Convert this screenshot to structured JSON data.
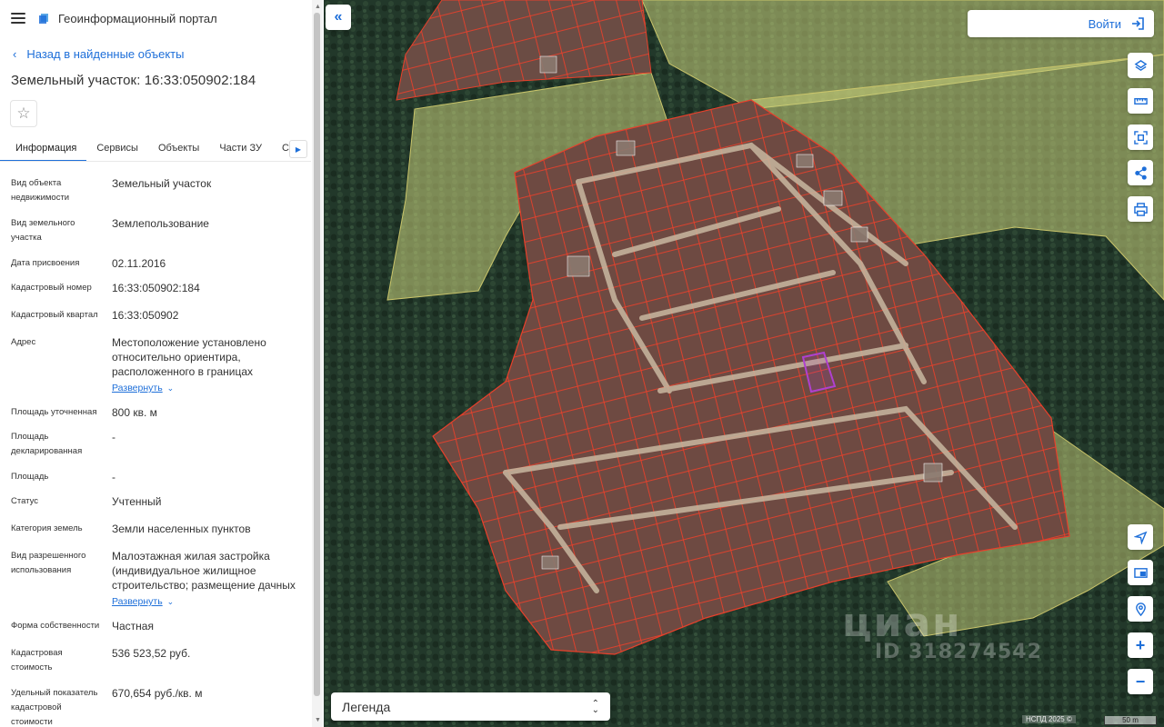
{
  "header": {
    "portal_title": "Геоинформационный портал"
  },
  "nav": {
    "back_label": "Назад в найденные объекты"
  },
  "object": {
    "title": "Земельный участок: 16:33:050902:184"
  },
  "tabs": [
    {
      "label": "Информация",
      "active": true
    },
    {
      "label": "Сервисы"
    },
    {
      "label": "Объекты"
    },
    {
      "label": "Части ЗУ"
    },
    {
      "label": "Сост"
    }
  ],
  "properties": [
    {
      "label": "Вид объекта недвижимости",
      "value": "Земельный участок"
    },
    {
      "label": "Вид земельного участка",
      "value": "Землепользование"
    },
    {
      "label": "Дата присвоения",
      "value": "02.11.2016"
    },
    {
      "label": "Кадастровый номер",
      "value": "16:33:050902:184"
    },
    {
      "label": "Кадастровый квартал",
      "value": "16:33:050902"
    },
    {
      "label": "Адрес",
      "value": "Местоположение установлено относительно ориентира, расположенного в границах",
      "expand": "Развернуть"
    },
    {
      "label": "Площадь уточненная",
      "value": "800 кв. м"
    },
    {
      "label": "Площадь декларированная",
      "value": "-"
    },
    {
      "label": "Площадь",
      "value": "-"
    },
    {
      "label": "Статус",
      "value": "Учтенный"
    },
    {
      "label": "Категория земель",
      "value": "Земли населенных пунктов"
    },
    {
      "label": "Вид разрешенного использования",
      "value": "Малоэтажная жилая застройка (индивидуальное жилищное строительство; размещение дачных",
      "expand": "Развернуть"
    },
    {
      "label": "Форма собственности",
      "value": "Частная"
    },
    {
      "label": "Кадастровая стоимость",
      "value": "536 523,52 руб."
    },
    {
      "label": "Удельный показатель кадастровой стоимости",
      "value": "670,654 руб./кв. м"
    }
  ],
  "map": {
    "login_label": "Войти",
    "legend_label": "Легенда",
    "watermark_logo": "циан",
    "watermark_id": "ID 318274542",
    "copyright": "НСПД 2025 ©",
    "scale_label": "50 m",
    "zoom_in": "+",
    "zoom_out": "−"
  },
  "colors": {
    "accent": "#1e6fd9",
    "parcel_border": "#e8402b",
    "selected_parcel": "#b040d0",
    "zone_fill": "#c9cf7a"
  }
}
